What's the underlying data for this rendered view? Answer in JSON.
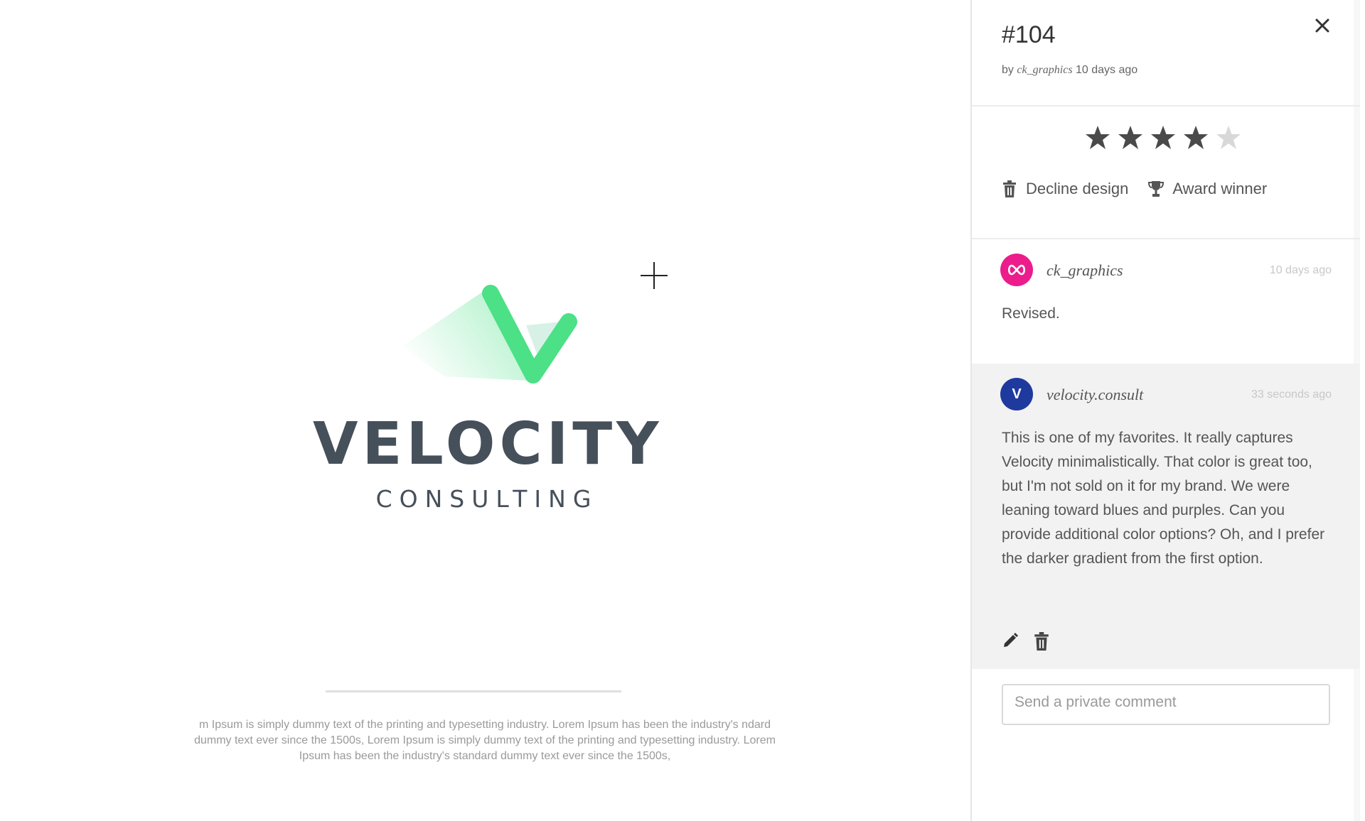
{
  "canvas": {
    "brand_name": "VELOCITY",
    "brand_subtitle": "CONSULTING",
    "lorem_text": "m Ipsum is simply dummy text of the printing and typesetting industry. Lorem Ipsum has been the industry's ndard dummy text ever since the 1500s, Lorem Ipsum is simply dummy text of the printing and typesetting industry. Lorem Ipsum has been the industry's standard dummy text ever since the 1500s,"
  },
  "panel": {
    "design_id": "#104",
    "meta_by": "by",
    "meta_author": "ck_graphics",
    "meta_time": "10 days ago",
    "close_icon": "close-icon",
    "rating": {
      "value": 4,
      "max": 5
    },
    "actions": {
      "decline_label": "Decline design",
      "award_label": "Award winner"
    },
    "comments": [
      {
        "author": "ck_graphics",
        "time": "10 days ago",
        "text": "Revised.",
        "avatar_color": "#ec1c8c"
      },
      {
        "author": "velocity.consult",
        "avatar_letter": "V",
        "time": "33 seconds ago",
        "text": "This is one of my favorites. It really captures Velocity minimalistically. That color is great too, but I'm not sold on it for my brand. We were leaning toward blues and purples. Can you provide additional color options? Oh, and I prefer the darker gradient from the first option.",
        "avatar_color": "#1f3a9e"
      }
    ],
    "comment_placeholder": "Send a private comment"
  },
  "colors": {
    "brand_green": "#4ce087",
    "brand_gray": "#46505a",
    "star_active": "#4a4a4a",
    "star_inactive": "#d8d8d8"
  }
}
